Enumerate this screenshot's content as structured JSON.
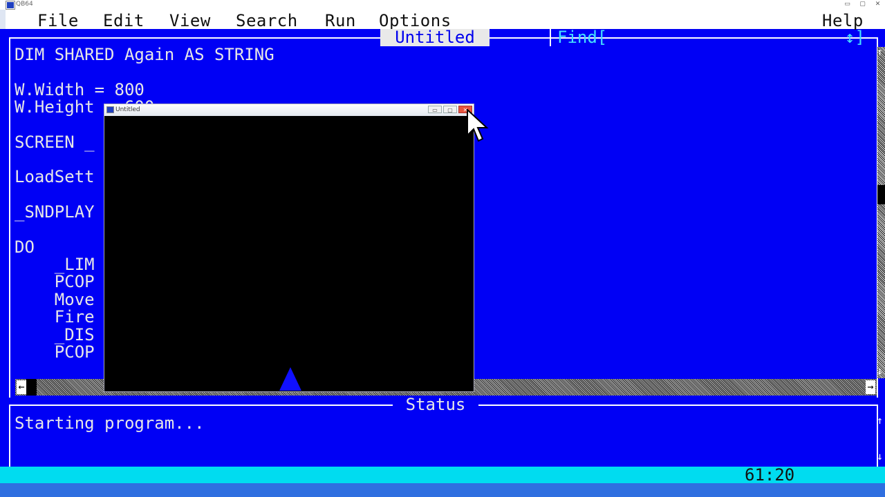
{
  "os_window": {
    "title": "QB64",
    "controls": [
      "▭",
      "▢",
      "✕"
    ]
  },
  "menu": {
    "file": "File",
    "edit": "Edit",
    "view": "View",
    "search": "Search",
    "run": "Run",
    "options": "Options",
    "help": "Help"
  },
  "editor": {
    "title": "Untitled",
    "find_label": "Find[",
    "updown_label": "↕]",
    "code_lines": [
      "DIM SHARED Again AS STRING",
      "W.Width = 800",
      "W.Height = 600",
      "SCREEN _",
      "LoadSett",
      "_SNDPLAY",
      "DO",
      "    _LIM",
      "    PCOP",
      "    Move",
      "    Fire",
      "    _DIS",
      "    PCOP"
    ],
    "scroll_left": "←",
    "scroll_right": "→",
    "scroll_up": "↑",
    "scroll_down": "↓"
  },
  "status": {
    "title": "Status",
    "message": "Starting program..."
  },
  "statusbar": {
    "position": "61:20"
  },
  "program_window": {
    "title": "Untitled",
    "minimize": "▭",
    "maximize": "▢",
    "close": "✕"
  },
  "colors": {
    "editor_bg": "#0000f5",
    "status_bar": "#00dcf0",
    "find_text": "#45e1ff",
    "ship": "#1010ff"
  }
}
